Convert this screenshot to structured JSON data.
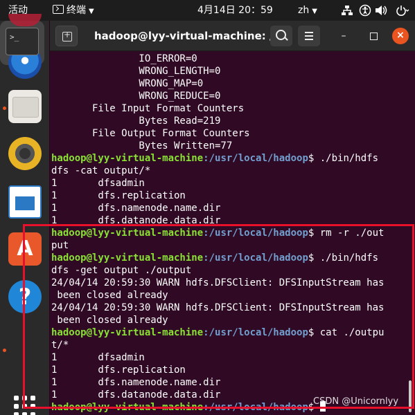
{
  "topbar": {
    "activities": "活动",
    "app_menu": "终端",
    "clock": "4月14日  20：59",
    "input_method": "zh"
  },
  "window": {
    "title": "hadoop@lyy-virtual-machine: /..."
  },
  "terminal": {
    "lines": [
      {
        "t": "               IO_ERROR=0"
      },
      {
        "t": "               WRONG_LENGTH=0"
      },
      {
        "t": "               WRONG_MAP=0"
      },
      {
        "t": "               WRONG_REDUCE=0"
      },
      {
        "t": "       File Input Format Counters"
      },
      {
        "t": "               Bytes Read=219"
      },
      {
        "t": "       File Output Format Counters"
      },
      {
        "t": "               Bytes Written=77"
      },
      {
        "user": "hadoop@lyy-virtual-machine",
        "path": ":/usr/local/hadoop",
        "cmd": "$ ./bin/hdfs"
      },
      {
        "t": "dfs -cat output/*"
      },
      {
        "t": "1       dfsadmin"
      },
      {
        "t": "1       dfs.replication"
      },
      {
        "t": "1       dfs.namenode.name.dir"
      },
      {
        "t": "1       dfs.datanode.data.dir"
      },
      {
        "user": "hadoop@lyy-virtual-machine",
        "path": ":/usr/local/hadoop",
        "cmd": "$ rm -r ./out"
      },
      {
        "t": "put"
      },
      {
        "user": "hadoop@lyy-virtual-machine",
        "path": ":/usr/local/hadoop",
        "cmd": "$ ./bin/hdfs"
      },
      {
        "t": "dfs -get output ./output"
      },
      {
        "t": "24/04/14 20:59:30 WARN hdfs.DFSClient: DFSInputStream has"
      },
      {
        "t": " been closed already"
      },
      {
        "t": "24/04/14 20:59:30 WARN hdfs.DFSClient: DFSInputStream has"
      },
      {
        "t": " been closed already"
      },
      {
        "user": "hadoop@lyy-virtual-machine",
        "path": ":/usr/local/hadoop",
        "cmd": "$ cat ./outpu"
      },
      {
        "t": "t/*"
      },
      {
        "t": "1       dfsadmin"
      },
      {
        "t": "1       dfs.replication"
      },
      {
        "t": "1       dfs.namenode.name.dir"
      },
      {
        "t": "1       dfs.datanode.data.dir"
      },
      {
        "user": "hadoop@lyy-virtual-machine",
        "path": ":/usr/local/hadoop",
        "cmd": "$ ",
        "cursor": true
      }
    ]
  },
  "watermark": "CSDN @Unicornlyy",
  "dock": {
    "icons": [
      "thunderbird-icon",
      "files-icon",
      "rhythmbox-icon",
      "writer-icon",
      "software-icon",
      "help-icon",
      "terminal-icon",
      "apps-grid-icon"
    ]
  },
  "colors": {
    "terminal_bg": "#300a24",
    "prompt_user": "#8ae234",
    "prompt_path": "#729fcf",
    "highlight": "#e8102a",
    "close": "#e95420"
  }
}
